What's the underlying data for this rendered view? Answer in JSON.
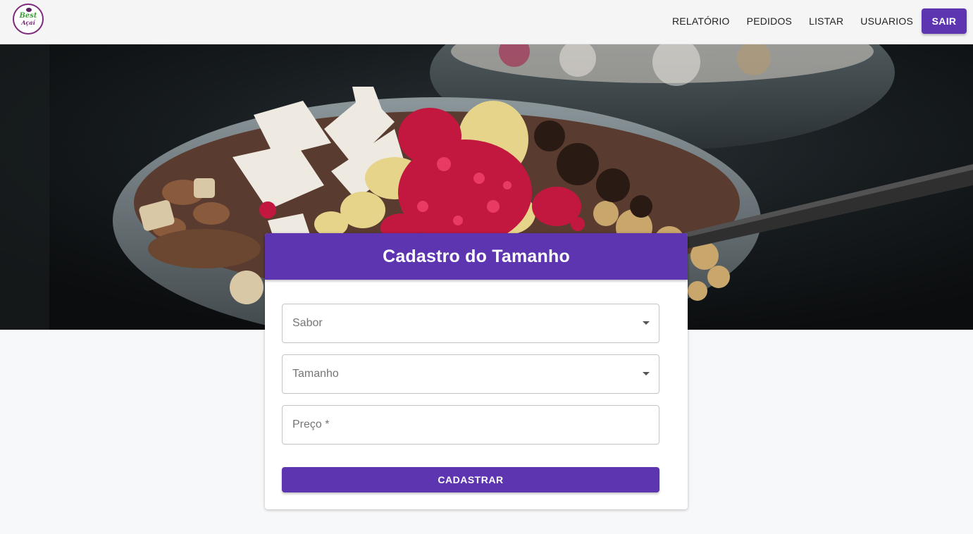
{
  "brand": {
    "logo_top": "Best",
    "logo_bottom": "Açaí"
  },
  "nav": {
    "items": [
      {
        "label": "RELATÓRIO"
      },
      {
        "label": "PEDIDOS"
      },
      {
        "label": "LISTAR"
      },
      {
        "label": "USUARIOS"
      }
    ],
    "exit_label": "SAIR"
  },
  "form": {
    "title": "Cadastro do Tamanho",
    "fields": {
      "flavor": {
        "placeholder": "Sabor",
        "type": "select"
      },
      "size": {
        "placeholder": "Tamanho",
        "type": "select"
      },
      "price": {
        "placeholder": "Preço *",
        "type": "text"
      }
    },
    "submit_label": "CADASTRAR"
  },
  "colors": {
    "primary": "#5e35b1",
    "topbar": "#f5f5f5",
    "page_bg": "#f7f8fa"
  },
  "icons": {
    "dropdown": "arrow-drop-down-icon"
  }
}
